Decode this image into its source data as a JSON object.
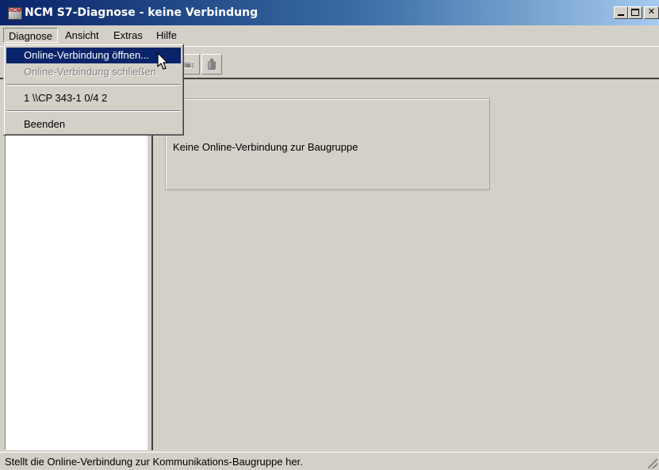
{
  "window": {
    "title": "NCM S7-Diagnose - keine Verbindung",
    "icon": "ncm-app-icon"
  },
  "menubar": {
    "items": [
      {
        "label": "Diagnose",
        "open": true
      },
      {
        "label": "Ansicht"
      },
      {
        "label": "Extras"
      },
      {
        "label": "Hilfe"
      }
    ]
  },
  "dropdown": {
    "items": [
      {
        "label": "Online-Verbindung öffnen...",
        "state": "selected"
      },
      {
        "label": "Online-Verbindung schließen",
        "state": "disabled"
      },
      {
        "label": "1 \\\\CP 343-1 0/4 2",
        "state": "normal"
      },
      {
        "label": "Beenden",
        "state": "normal"
      }
    ]
  },
  "toolbar": {
    "buttons": [
      {
        "icon": "connect-plug-icon",
        "state": "disabled"
      },
      {
        "icon": "disconnect-icon",
        "state": "disabled"
      }
    ]
  },
  "main": {
    "info_text": "Keine Online-Verbindung zur Baugruppe"
  },
  "statusbar": {
    "text": "Stellt die Online-Verbindung zur Kommunikations-Baugruppe her."
  },
  "colors": {
    "title_active": "#0a246a",
    "selection": "#0a246a",
    "face": "#d4d0c8"
  }
}
